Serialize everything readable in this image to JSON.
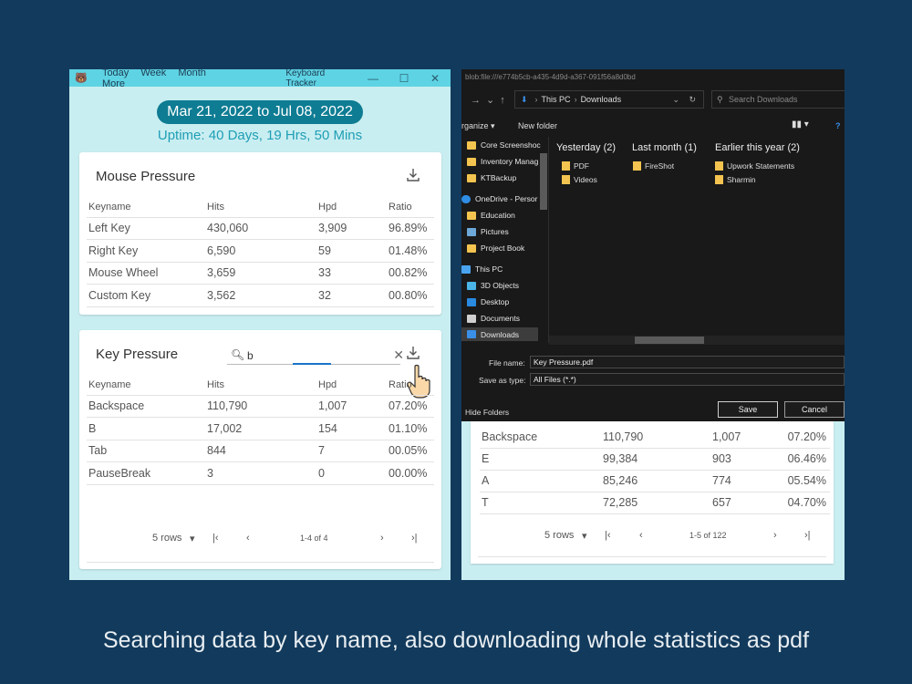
{
  "app": {
    "menu": [
      "Today",
      "Week",
      "Month",
      "More"
    ],
    "window_title": "Keyboard Tracker",
    "window_controls": [
      "—",
      "☐",
      "✕"
    ],
    "date_range": "Mar 21, 2022 to Jul 08, 2022",
    "uptime": "Uptime: 40 Days, 19 Hrs, 50 Mins"
  },
  "mouse_pressure": {
    "title": "Mouse Pressure",
    "columns": [
      "Keyname",
      "Hits",
      "Hpd",
      "Ratio"
    ],
    "rows": [
      [
        "Left Key",
        "430,060",
        "3,909",
        "96.89%"
      ],
      [
        "Right Key",
        "6,590",
        "59",
        "01.48%"
      ],
      [
        "Mouse Wheel",
        "3,659",
        "33",
        "00.82%"
      ],
      [
        "Custom Key",
        "3,562",
        "32",
        "00.80%"
      ]
    ]
  },
  "key_pressure": {
    "title": "Key Pressure",
    "search_value": "b",
    "columns": [
      "Keyname",
      "Hits",
      "Hpd",
      "Ratio"
    ],
    "rows": [
      [
        "Backspace",
        "110,790",
        "1,007",
        "07.20%"
      ],
      [
        "B",
        "17,002",
        "154",
        "01.10%"
      ],
      [
        "Tab",
        "844",
        "7",
        "00.05%"
      ],
      [
        "PauseBreak",
        "3",
        "0",
        "00.00%"
      ]
    ],
    "rows_per_page": "5 rows",
    "page_info": "1-4 of 4"
  },
  "dialog": {
    "url": "blob:file:///e774b5cb-a435-4d9d-a367-091f56a8d0bd",
    "path": [
      "This PC",
      "Downloads"
    ],
    "search_placeholder": "Search Downloads",
    "organize": "rganize ▾",
    "new_folder": "New folder",
    "nav_items": [
      "Core Screenshoc",
      "Inventory Manag",
      "KTBackup",
      "OneDrive - Persor",
      "Education",
      "Pictures",
      "Project Book",
      "This PC",
      "3D Objects",
      "Desktop",
      "Documents",
      "Downloads"
    ],
    "groups": [
      {
        "name": "Yesterday (2)",
        "items": [
          "PDF",
          "Videos"
        ]
      },
      {
        "name": "Last month (1)",
        "items": [
          "FireShot"
        ]
      },
      {
        "name": "Earlier this year (2)",
        "items": [
          "Upwork Statements",
          "Sharmin"
        ]
      }
    ],
    "file_name_label": "File name:",
    "file_name": "Key Pressure.pdf",
    "save_type_label": "Save as type:",
    "save_type": "All Files (*.*)",
    "hide_folders": "Hide Folders",
    "save": "Save",
    "cancel": "Cancel"
  },
  "bg_table": {
    "rows": [
      [
        "Backspace",
        "110,790",
        "1,007",
        "07.20%"
      ],
      [
        "E",
        "99,384",
        "903",
        "06.46%"
      ],
      [
        "A",
        "85,246",
        "774",
        "05.54%"
      ],
      [
        "T",
        "72,285",
        "657",
        "04.70%"
      ]
    ],
    "rows_per_page": "5 rows",
    "page_info": "1-5 of 122"
  },
  "caption": "Searching data by key name, also downloading whole statistics as pdf"
}
